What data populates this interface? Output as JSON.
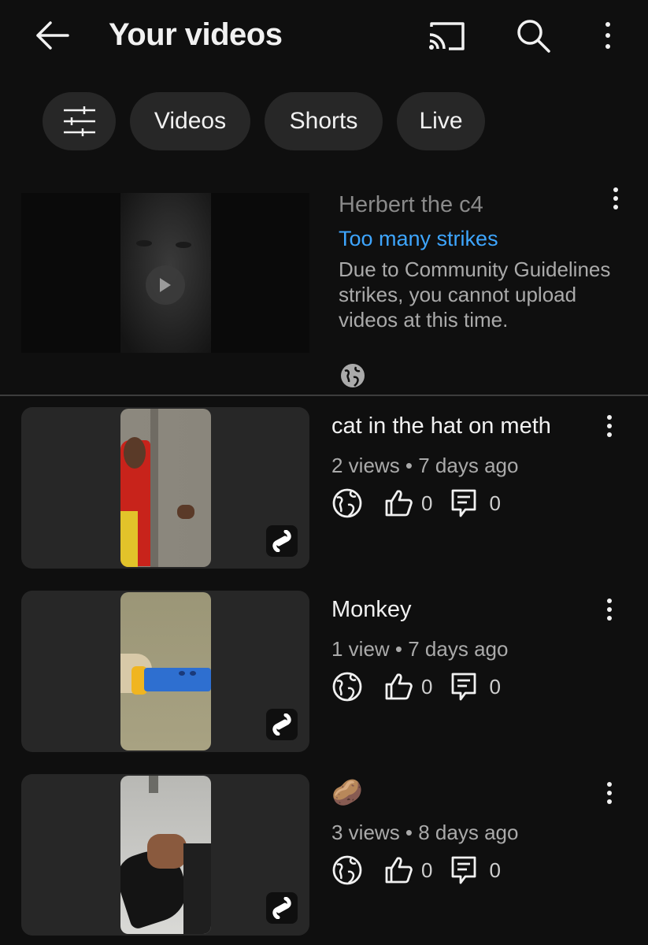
{
  "header": {
    "title": "Your videos"
  },
  "filters": {
    "chips": [
      "Videos",
      "Shorts",
      "Live"
    ]
  },
  "blocked_video": {
    "title": "Herbert the c4",
    "status": "Too many strikes",
    "description": "Due to Community Guidelines strikes, you cannot upload videos at this time."
  },
  "videos": [
    {
      "title": "cat in the hat on meth",
      "meta": "2 views • 7 days ago",
      "likes": "0",
      "comments": "0"
    },
    {
      "title": "Monkey",
      "meta": "1 view • 7 days ago",
      "likes": "0",
      "comments": "0"
    },
    {
      "title": "🥔",
      "meta": "3 views • 8 days ago",
      "likes": "0",
      "comments": "0"
    }
  ],
  "colors": {
    "background": "#0f0f0f",
    "chip_bg": "#272727",
    "link_blue": "#3ea6ff",
    "muted_text": "#aaaaaa"
  },
  "icons": [
    "back-arrow-icon",
    "cast-icon",
    "search-icon",
    "more-vert-icon",
    "filter-sliders-icon",
    "play-icon",
    "globe-icon",
    "thumb-up-icon",
    "comment-icon",
    "shorts-logo-icon"
  ]
}
